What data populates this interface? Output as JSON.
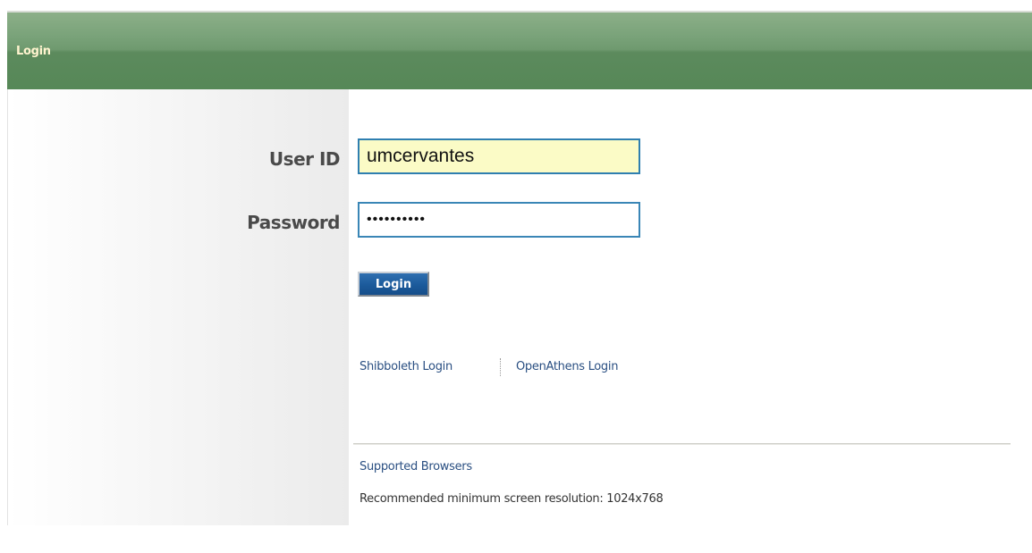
{
  "header": {
    "title": "Login"
  },
  "form": {
    "user_id_label": "User ID",
    "user_id_value": "umcervantes",
    "password_label": "Password",
    "password_value": "••••••••••",
    "login_button_label": "Login"
  },
  "links": {
    "shibboleth": "Shibboleth Login",
    "openathens": "OpenAthens Login"
  },
  "footer": {
    "supported_browsers": "Supported Browsers",
    "resolution_note": "Recommended minimum screen resolution: 1024x768"
  },
  "colors": {
    "header_green": "#5c8a5d",
    "header_title": "#fff4cf",
    "input_border": "#2f7fb0",
    "userid_bg": "#fbfbc6",
    "button_blue": "#1b5a9b",
    "link_blue": "#2a4f82"
  }
}
